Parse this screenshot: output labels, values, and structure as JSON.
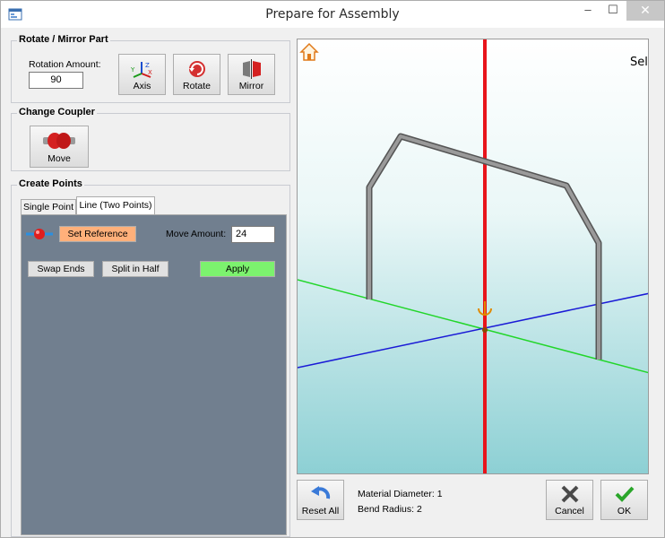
{
  "window": {
    "title": "Prepare for Assembly",
    "minimize_glyph": "‒",
    "maximize_glyph": "☐",
    "close_glyph": "✕"
  },
  "rotate_group": {
    "title": "Rotate / Mirror Part",
    "rotation_label": "Rotation Amount:",
    "rotation_value": "90",
    "axis_label": "Axis",
    "rotate_label": "Rotate",
    "mirror_label": "Mirror"
  },
  "coupler_group": {
    "title": "Change Coupler",
    "move_label": "Move"
  },
  "points_group": {
    "title": "Create Points",
    "tabs": [
      {
        "label": "Single Point",
        "active": false
      },
      {
        "label": "Line (Two Points)",
        "active": true
      }
    ],
    "set_reference_label": "Set Reference",
    "move_amount_label": "Move Amount:",
    "move_amount_value": "24",
    "swap_ends_label": "Swap Ends",
    "split_half_label": "Split in Half",
    "apply_label": "Apply"
  },
  "viewport": {
    "overlay_text": "Sele",
    "colors": {
      "z_axis": "#e8141b",
      "x_axis": "#1a1ad6",
      "y_axis": "#22d62a",
      "tube": "#8a8a8a",
      "reference_button": "#ffb07a",
      "apply_button": "#7cf26e"
    }
  },
  "footer": {
    "reset_all_label": "Reset All",
    "material_diameter": "Material Diameter: 1",
    "bend_radius": "Bend Radius: 2",
    "cancel_label": "Cancel",
    "ok_label": "OK"
  }
}
